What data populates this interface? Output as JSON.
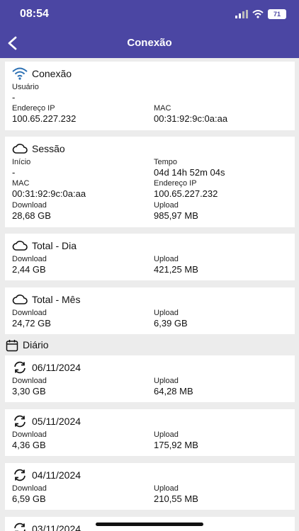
{
  "status": {
    "time": "08:54",
    "battery": "71"
  },
  "header": {
    "title": "Conexão"
  },
  "conexao": {
    "title": "Conexão",
    "usuario_label": "Usuário",
    "usuario_value": "-",
    "ip_label": "Endereço IP",
    "ip_value": "100.65.227.232",
    "mac_label": "MAC",
    "mac_value": "00:31:92:9c:0a:aa"
  },
  "sessao": {
    "title": "Sessão",
    "inicio_label": "Início",
    "inicio_value": "-",
    "tempo_label": "Tempo",
    "tempo_value": "04d 14h 52m 04s",
    "mac_label": "MAC",
    "mac_value": "00:31:92:9c:0a:aa",
    "ip_label": "Endereço IP",
    "ip_value": "100.65.227.232",
    "download_label": "Download",
    "download_value": "28,68 GB",
    "upload_label": "Upload",
    "upload_value": "985,97 MB"
  },
  "total_dia": {
    "title": "Total - Dia",
    "download_label": "Download",
    "download_value": "2,44 GB",
    "upload_label": "Upload",
    "upload_value": "421,25 MB"
  },
  "total_mes": {
    "title": "Total - Mês",
    "download_label": "Download",
    "download_value": "24,72 GB",
    "upload_label": "Upload",
    "upload_value": "6,39 GB"
  },
  "diario": {
    "label": "Diário",
    "days": [
      {
        "date": "06/11/2024",
        "download_label": "Download",
        "download": "3,30 GB",
        "upload_label": "Upload",
        "upload": "64,28 MB"
      },
      {
        "date": "05/11/2024",
        "download_label": "Download",
        "download": "4,36 GB",
        "upload_label": "Upload",
        "upload": "175,92 MB"
      },
      {
        "date": "04/11/2024",
        "download_label": "Download",
        "download": "6,59 GB",
        "upload_label": "Upload",
        "upload": "210,55 MB"
      },
      {
        "date": "03/11/2024"
      }
    ]
  }
}
